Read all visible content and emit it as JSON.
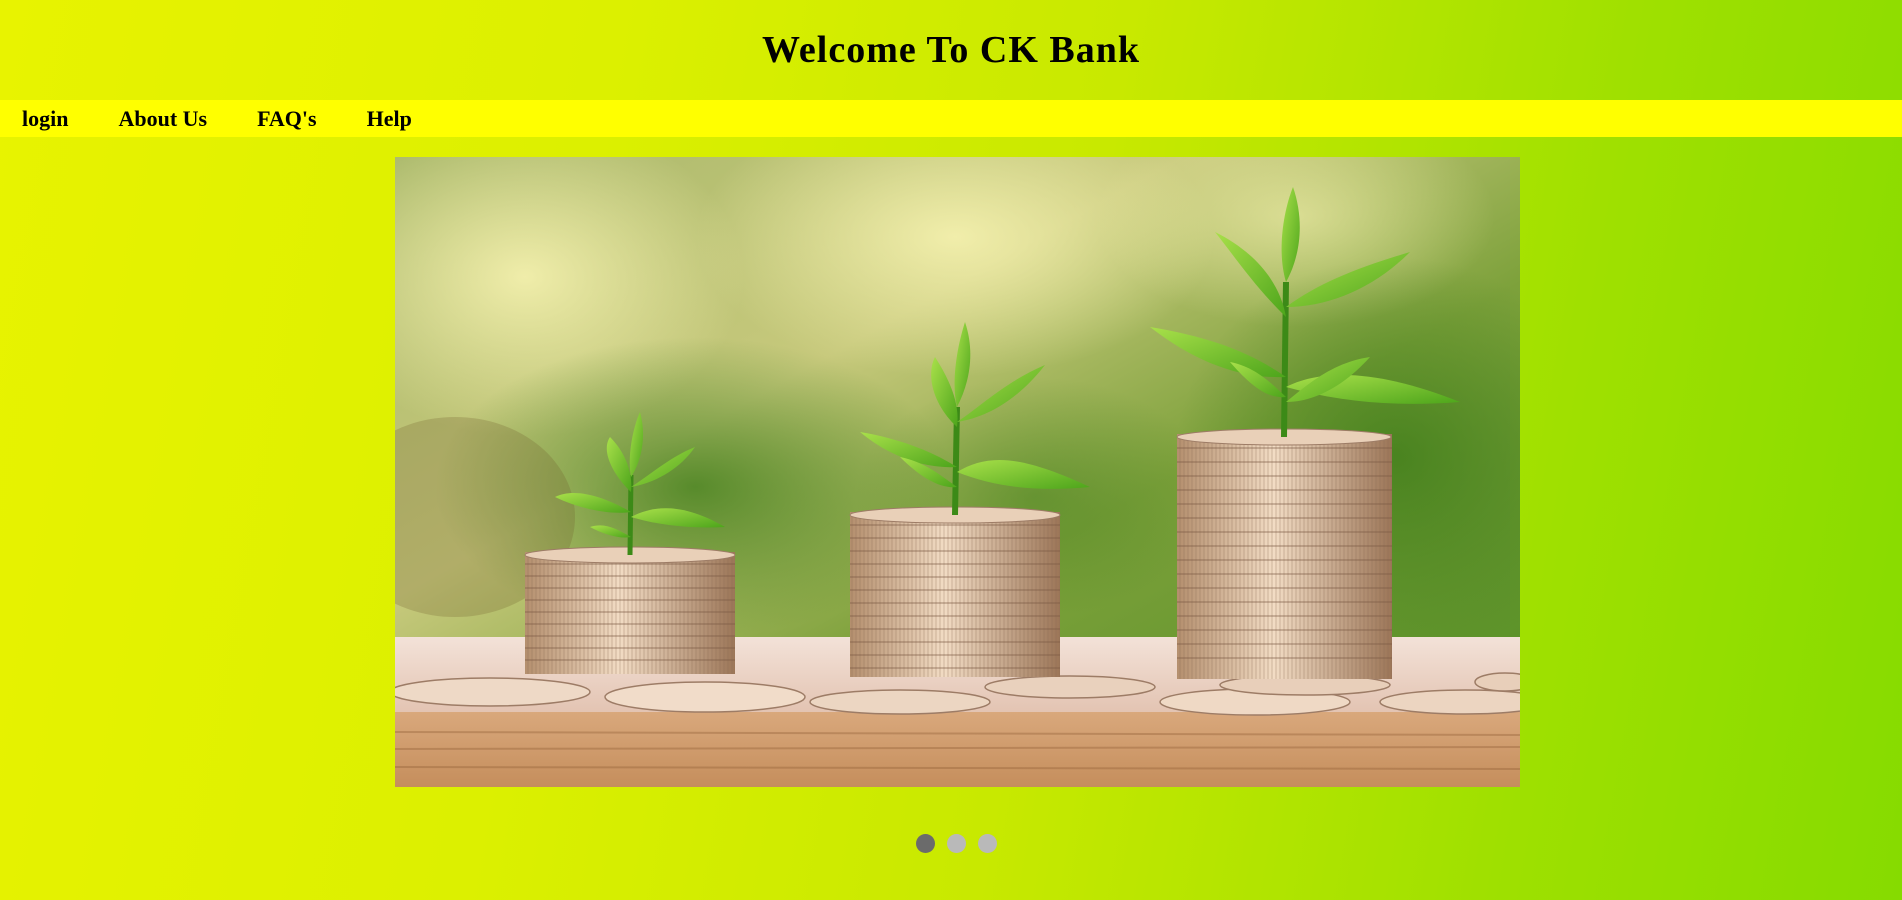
{
  "header": {
    "title": "Welcome To CK Bank"
  },
  "nav": {
    "items": [
      {
        "label": "login",
        "name": "nav-login"
      },
      {
        "label": "About Us",
        "name": "nav-about-us"
      },
      {
        "label": "FAQ's",
        "name": "nav-faqs"
      },
      {
        "label": "Help",
        "name": "nav-help"
      }
    ]
  },
  "slideshow": {
    "image_subject": "coin-stacks-with-growing-plants",
    "slide_count": 3,
    "active_index": 0
  },
  "colors": {
    "nav_background": "#ffff00",
    "dot_active": "#6b6b6b",
    "dot_inactive": "#b9b9b9"
  }
}
